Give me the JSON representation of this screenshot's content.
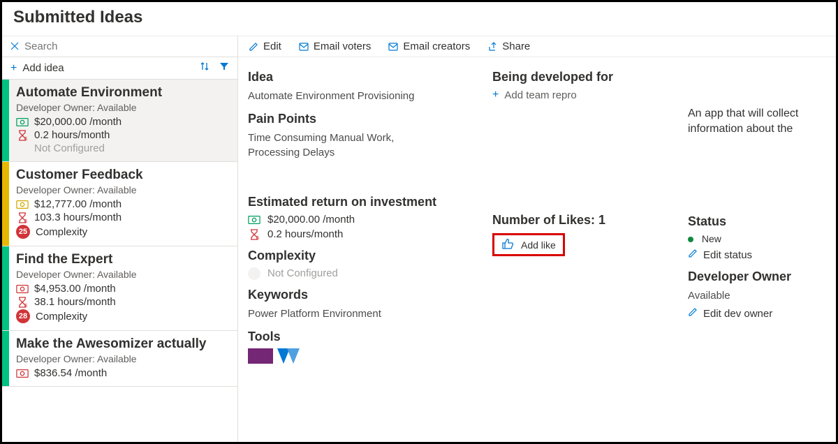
{
  "page_title": "Submitted Ideas",
  "search": {
    "placeholder": "Search"
  },
  "add_idea": {
    "label": "Add idea"
  },
  "toolbar": {
    "edit": "Edit",
    "email_voters": "Email voters",
    "email_creators": "Email creators",
    "share": "Share"
  },
  "ideas": [
    {
      "title": "Automate Environment",
      "owner": "Developer Owner: Available",
      "money": "$20,000.00 /month",
      "hours": "0.2 hours/month",
      "complexity": "Not Configured",
      "stripe": "green",
      "badge": "",
      "muted_complexity": true,
      "money_color": "green"
    },
    {
      "title": "Customer Feedback",
      "owner": "Developer Owner: Available",
      "money": "$12,777.00 /month",
      "hours": "103.3 hours/month",
      "complexity": "Complexity",
      "stripe": "yellow",
      "badge": "25",
      "money_color": "yellow"
    },
    {
      "title": "Find the Expert",
      "owner": "Developer Owner: Available",
      "money": "$4,953.00 /month",
      "hours": "38.1 hours/month",
      "complexity": "Complexity",
      "stripe": "green",
      "badge": "28",
      "money_color": "red"
    },
    {
      "title": "Make the Awesomizer actually",
      "owner": "Developer Owner: Available",
      "money": "$836.54 /month",
      "hours": "",
      "complexity": "",
      "stripe": "green",
      "badge": "",
      "money_color": "red"
    }
  ],
  "detail": {
    "idea_h": "Idea",
    "idea_v": "Automate Environment Provisioning",
    "pain_h": "Pain Points",
    "pain_v": "Time Consuming Manual Work, Processing Delays",
    "roi_h": "Estimated return on investment",
    "roi_money": "$20,000.00 /month",
    "roi_hours": "0.2 hours/month",
    "complexity_h": "Complexity",
    "complexity_v": "Not Configured",
    "keywords_h": "Keywords",
    "keywords_v": "Power Platform Environment",
    "tools_h": "Tools",
    "being_h": "Being developed for",
    "add_repro": "Add team repro",
    "likes_h": "Number of Likes: 1",
    "add_like": "Add like",
    "description": "An app that will collect information about the",
    "status_h": "Status",
    "status_v": "New",
    "edit_status": "Edit status",
    "devowner_h": "Developer Owner",
    "devowner_v": "Available",
    "edit_devowner": "Edit dev owner"
  }
}
